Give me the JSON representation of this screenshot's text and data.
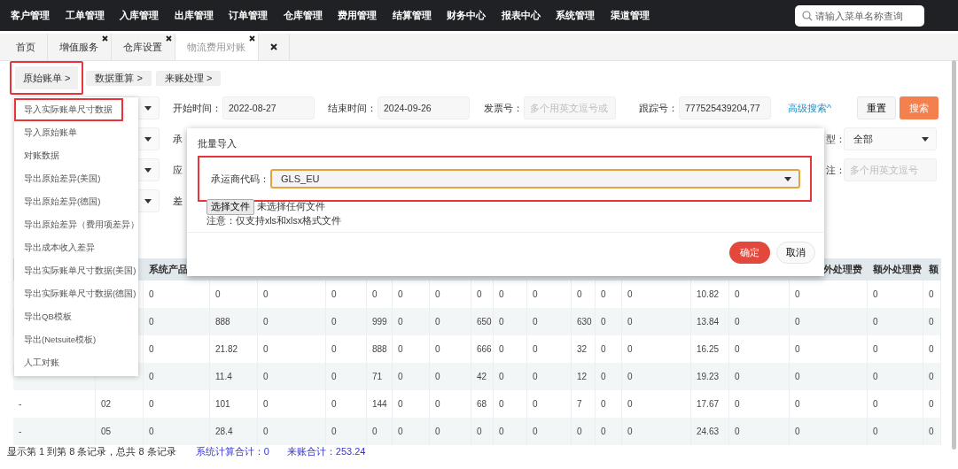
{
  "top_nav": {
    "items": [
      "客户管理",
      "工单管理",
      "入库管理",
      "出库管理",
      "订单管理",
      "仓库管理",
      "费用管理",
      "结算管理",
      "财务中心",
      "报表中心",
      "系统管理",
      "渠道管理"
    ],
    "search": {
      "placeholder": "请输入菜单名称查询"
    }
  },
  "tabs": [
    {
      "kind": "page",
      "label": "首页",
      "selected": false,
      "closable": false
    },
    {
      "kind": "page",
      "label": "增值服务",
      "selected": false,
      "closable": true
    },
    {
      "kind": "page",
      "label": "仓库设置",
      "selected": false,
      "closable": true
    },
    {
      "kind": "page",
      "label": "物流费用对账",
      "selected": true,
      "closable": true
    },
    {
      "kind": "close",
      "selected": false
    }
  ],
  "toolbar": [
    {
      "label": "原始账单 >",
      "highlighted": true
    },
    {
      "label": "数据重算 >",
      "highlighted": false
    },
    {
      "label": "来账处理 >",
      "highlighted": false
    }
  ],
  "dropdown_menu": {
    "items": [
      {
        "label": "导入实际账单尺寸数据",
        "highlighted": true
      },
      {
        "label": "导入原始账单",
        "highlighted": false
      },
      {
        "label": "对账数据",
        "highlighted": false
      },
      {
        "label": "导出原始差异(美国)",
        "highlighted": false
      },
      {
        "label": "导出原始差异(德国)",
        "highlighted": false
      },
      {
        "label": "导出原始差异（费用项差异）",
        "highlighted": false
      },
      {
        "label": "导出成本收入差异",
        "highlighted": false
      },
      {
        "label": "导出实际账单尺寸数据(美国)",
        "highlighted": false
      },
      {
        "label": "导出实际账单尺寸数据(德国)",
        "highlighted": false
      },
      {
        "label": "导出QB模板",
        "highlighted": false
      },
      {
        "label": "导出(Netsuite模板)",
        "highlighted": false
      },
      {
        "label": "人工对账",
        "highlighted": false
      }
    ]
  },
  "filters": {
    "start_time": {
      "label": "开始时间：",
      "value": "2022-08-27"
    },
    "end_time": {
      "label": "结束时间：",
      "value": "2024-09-26"
    },
    "invoice_no": {
      "label": "发票号：",
      "placeholder": "多个用英文逗号或"
    },
    "tracking_no": {
      "label": "跟踪号：",
      "value": "777525439204,77"
    },
    "advanced_search_link": "高级搜索^",
    "reset_button": "重置",
    "search_button": "搜索",
    "partial_labels": [
      "承",
      "应",
      "差"
    ],
    "type": {
      "label": "型：",
      "value": "全部"
    },
    "remark": {
      "label": "注：",
      "placeholder": "多个用英文逗号"
    }
  },
  "modal": {
    "title": "批量导入",
    "carrier_field": {
      "label": "承运商代码：",
      "value": "GLS_EU",
      "focused": true,
      "highlighted": true
    },
    "file_button": "选择文件",
    "file_status": "未选择任何文件",
    "note": "注意：仅支持xls和xlsx格式文件",
    "confirm_button": "确定",
    "cancel_button": "取消"
  },
  "table": {
    "header": {
      "column_3": "系统产品",
      "column_18": "外处理费",
      "column_19": "额外处理费",
      "column_20": "额"
    },
    "rows": [
      {
        "values": [
          "0",
          "0",
          "0",
          "0",
          "0",
          "0",
          "0",
          "0",
          "0",
          "0",
          "0",
          "0",
          "0",
          "10.82",
          "0",
          "0",
          "0",
          "0"
        ]
      },
      {
        "values": [
          "0",
          "888",
          "0",
          "0",
          "999",
          "0",
          "0",
          "650",
          "0",
          "0",
          "630",
          "0",
          "0",
          "13.84",
          "0",
          "0",
          "0",
          "0"
        ]
      },
      {
        "values": [
          "0",
          "21.82",
          "0",
          "0",
          "888",
          "0",
          "0",
          "666",
          "0",
          "0",
          "32",
          "0",
          "0",
          "16.25",
          "0",
          "0",
          "0",
          "0"
        ]
      },
      {
        "values": [
          "0",
          "11.4",
          "0",
          "0",
          "71",
          "0",
          "0",
          "42",
          "0",
          "0",
          "12",
          "0",
          "0",
          "19.23",
          "0",
          "0",
          "0",
          "0"
        ]
      },
      {
        "column_1": "-",
        "column_2": "02",
        "values": [
          "0",
          "101",
          "0",
          "0",
          "144",
          "0",
          "0",
          "68",
          "0",
          "0",
          "7",
          "0",
          "0",
          "17.67",
          "0",
          "0",
          "0",
          "0"
        ]
      },
      {
        "column_1": "-",
        "column_2": "05",
        "values": [
          "0",
          "28.4",
          "0",
          "0",
          "0",
          "0",
          "0",
          "0",
          "0",
          "0",
          "0",
          "0",
          "0",
          "24.63",
          "0",
          "0",
          "0",
          "0"
        ]
      }
    ]
  },
  "status_bar": {
    "records": "显示第 1 到第 8 条记录，总共 8 条记录",
    "system_total": "系统计算合计：0",
    "incoming_total": "来账合计：253.24"
  }
}
